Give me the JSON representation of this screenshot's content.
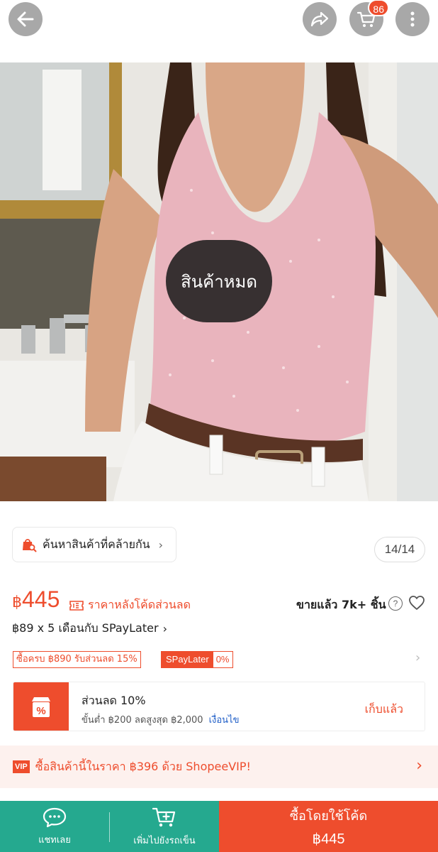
{
  "header": {
    "cart_count": "86",
    "icons": [
      "back-arrow-icon",
      "share-icon",
      "cart-icon",
      "more-icon"
    ]
  },
  "product_image": {
    "overlay_label": "สินค้าหมด",
    "counter": "14/14"
  },
  "similar": {
    "label": "ค้นหาสินค้าที่คล้ายกัน",
    "chevron": "›"
  },
  "pricing": {
    "currency": "฿",
    "amount": "445",
    "after_code_label": "ราคาหลังโค้ดส่วนลด",
    "sold_label": "ขายแล้ว 7k+ ชิ้น",
    "help": "?",
    "installment": "฿89 x 5 เดือนกับ SPayLater",
    "installment_chevron": "›"
  },
  "tags": {
    "spend_discount": "ซื้อครบ ฿890 รับส่วนลด 15%",
    "spaylater_label": "SPayLater",
    "spaylater_rate": "0%",
    "chevron": "›"
  },
  "voucher": {
    "title": "ส่วนลด 10%",
    "condition": "ขั้นต่ำ ฿200 ลดสูงสุด ฿2,000",
    "terms_link": "เงื่อนไข",
    "claim_label": "เก็บแล้ว"
  },
  "vip": {
    "badge": "VIP",
    "text": "ซื้อสินค้านี้ในราคา ฿396 ด้วย ShopeeVIP!",
    "chevron": "›"
  },
  "bottom_bar": {
    "chat_label": "แชทเลย",
    "add_to_cart_label": "เพิ่มไปยังรถเข็น",
    "buy_label": "ซื้อโดยใช้โค้ด",
    "buy_price": "฿445"
  },
  "colors": {
    "accent": "#ee4d2d",
    "teal": "#25a98f",
    "link": "#1f5ec7"
  }
}
